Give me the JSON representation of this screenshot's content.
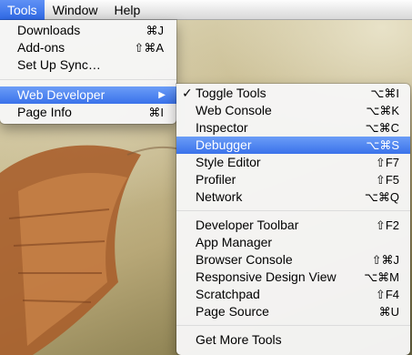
{
  "menubar": {
    "items": [
      "Tools",
      "Window",
      "Help"
    ]
  },
  "tools_menu": {
    "items": [
      {
        "label": "Downloads",
        "shortcut": "⌘J"
      },
      {
        "label": "Add-ons",
        "shortcut": "⇧⌘A"
      },
      {
        "label": "Set Up Sync…",
        "shortcut": ""
      },
      {
        "label": "Web Developer",
        "shortcut": "▶"
      },
      {
        "label": "Page Info",
        "shortcut": "⌘I"
      }
    ]
  },
  "dev_menu": {
    "items": [
      {
        "label": "Toggle Tools",
        "shortcut": "⌥⌘I",
        "checked": "✓"
      },
      {
        "label": "Web Console",
        "shortcut": "⌥⌘K"
      },
      {
        "label": "Inspector",
        "shortcut": "⌥⌘C"
      },
      {
        "label": "Debugger",
        "shortcut": "⌥⌘S"
      },
      {
        "label": "Style Editor",
        "shortcut": "⇧F7"
      },
      {
        "label": "Profiler",
        "shortcut": "⇧F5"
      },
      {
        "label": "Network",
        "shortcut": "⌥⌘Q"
      },
      {
        "label": "Developer Toolbar",
        "shortcut": "⇧F2"
      },
      {
        "label": "App Manager",
        "shortcut": ""
      },
      {
        "label": "Browser Console",
        "shortcut": "⇧⌘J"
      },
      {
        "label": "Responsive Design View",
        "shortcut": "⌥⌘M"
      },
      {
        "label": "Scratchpad",
        "shortcut": "⇧F4"
      },
      {
        "label": "Page Source",
        "shortcut": "⌘U"
      },
      {
        "label": "Get More Tools",
        "shortcut": ""
      }
    ]
  },
  "colors": {
    "highlight": "#3a72ea",
    "menu_bg": "#f6f6f6"
  }
}
